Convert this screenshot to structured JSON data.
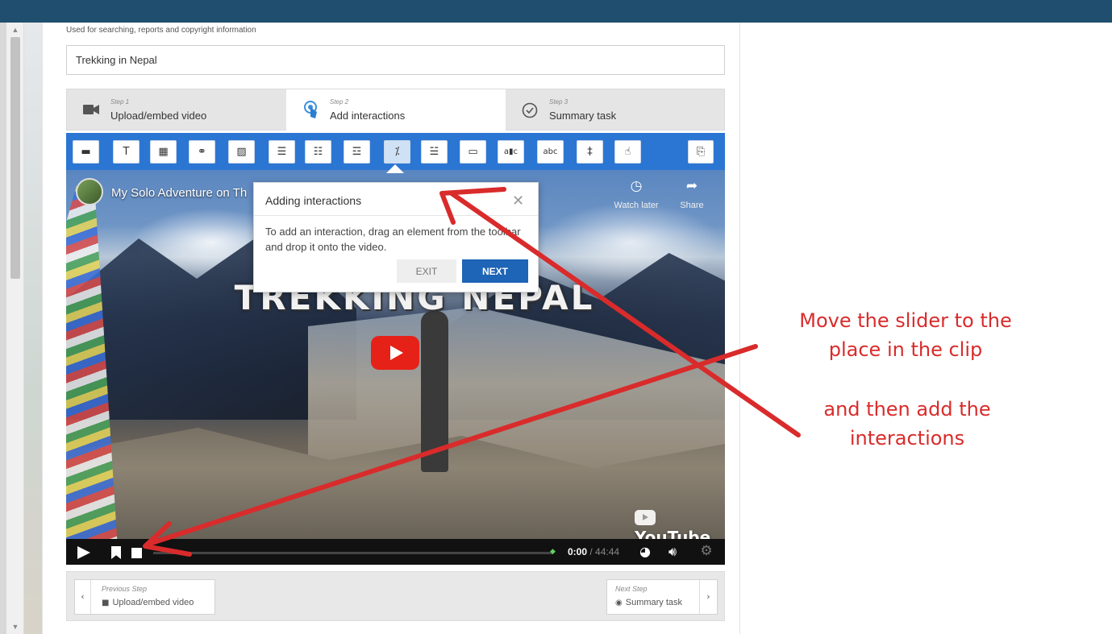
{
  "form": {
    "title_hint": "Used for searching, reports and copyright information",
    "title_value": "Trekking in Nepal"
  },
  "steps": [
    {
      "num": "Step 1",
      "label": "Upload/embed video",
      "icon": "video-camera-icon"
    },
    {
      "num": "Step 2",
      "label": "Add interactions",
      "icon": "touch-icon"
    },
    {
      "num": "Step 3",
      "label": "Summary task",
      "icon": "check-circle-icon"
    }
  ],
  "toolbar": {
    "tools": [
      {
        "glyph": "▬",
        "icon": "label-icon"
      },
      {
        "glyph": "T",
        "icon": "text-icon"
      },
      {
        "glyph": "▦",
        "icon": "table-icon"
      },
      {
        "glyph": "⚭",
        "icon": "link-icon"
      },
      {
        "glyph": "▨",
        "icon": "image-icon"
      },
      {
        "glyph": "☰",
        "icon": "statements-icon"
      },
      {
        "glyph": "☷",
        "icon": "single-choice-icon"
      },
      {
        "glyph": "☲",
        "icon": "multiple-choice-icon"
      },
      {
        "glyph": "⁒",
        "icon": "true-false-icon"
      },
      {
        "glyph": "☱",
        "icon": "fill-blanks-icon"
      },
      {
        "glyph": "▭",
        "icon": "drag-drop-icon"
      },
      {
        "glyph": "a▮c",
        "icon": "mark-words-icon"
      },
      {
        "glyph": "abc",
        "icon": "drag-text-icon"
      },
      {
        "glyph": "‡",
        "icon": "crossroads-icon"
      },
      {
        "glyph": "☝",
        "icon": "navigation-hotspot-icon"
      }
    ],
    "paste_glyph": "⎘",
    "paste_icon": "paste-icon"
  },
  "video": {
    "title": "My Solo Adventure on Th",
    "watch_later": "Watch later",
    "share": "Share",
    "overlay_text": "TREKKING NEPAL",
    "brand": "YouTube",
    "current_time": "0:00",
    "duration": "44:44",
    "time_separator": " / "
  },
  "popup": {
    "title": "Adding interactions",
    "close_glyph": "✕",
    "text": "To add an interaction, drag an element from the toolbar and drop it onto the video.",
    "exit_label": "EXIT",
    "next_label": "NEXT"
  },
  "nav": {
    "prev_caption": "Previous Step",
    "prev_label": "Upload/embed video",
    "next_caption": "Next Step",
    "next_label": "Summary task"
  },
  "annotation": {
    "line1": "Move the slider to the",
    "line2": "place in the clip",
    "line3": "and then add the",
    "line4": "interactions",
    "color": "#d92b2b"
  },
  "colors": {
    "top_bar": "#1f4e6e",
    "toolbar": "#2b76d3",
    "next_button": "#1e64b7",
    "youtube_red": "#e62117"
  }
}
